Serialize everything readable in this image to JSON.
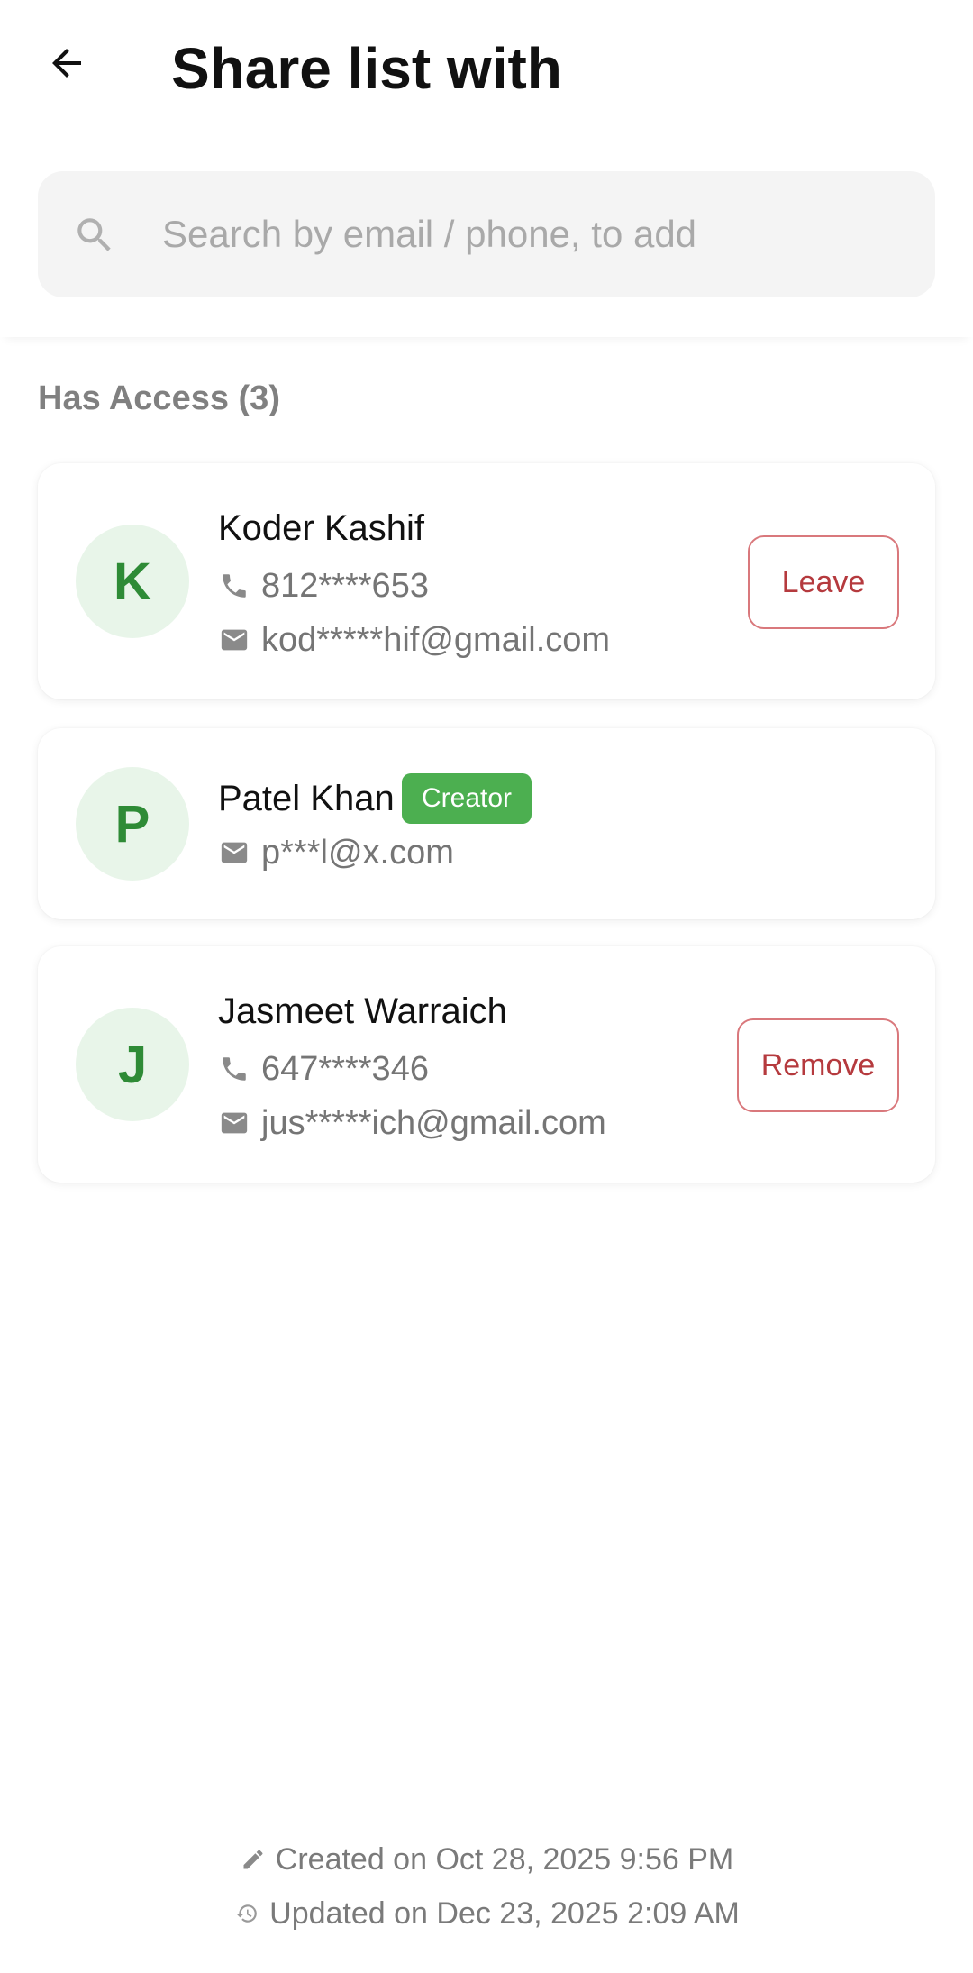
{
  "header": {
    "title": "Share list with"
  },
  "search": {
    "placeholder": "Search by email / phone, to add"
  },
  "section": {
    "title": "Has Access (3)"
  },
  "members": [
    {
      "initial": "K",
      "name": "Koder Kashif",
      "phone": "812****653",
      "email": "kod*****hif@gmail.com",
      "action_label": "Leave"
    },
    {
      "initial": "P",
      "name": "Patel Khan",
      "badge": "Creator",
      "email": "p***l@x.com"
    },
    {
      "initial": "J",
      "name": "Jasmeet Warraich",
      "phone": "647****346",
      "email": "jus*****ich@gmail.com",
      "action_label": "Remove"
    }
  ],
  "footer": {
    "created": "Created on Oct 28, 2025 9:56 PM",
    "updated": "Updated on Dec 23, 2025 2:09 AM"
  },
  "icons": {
    "back": "arrow-back-icon",
    "search": "search-icon",
    "phone": "phone-icon",
    "email": "email-icon",
    "edit": "pencil-icon",
    "updated": "history-icon"
  },
  "colors": {
    "accent_green": "#4caf50",
    "avatar_bg": "#e8f5e9",
    "avatar_text": "#2e8b36",
    "danger_text": "#b53a3e",
    "danger_border": "#d9787c"
  }
}
